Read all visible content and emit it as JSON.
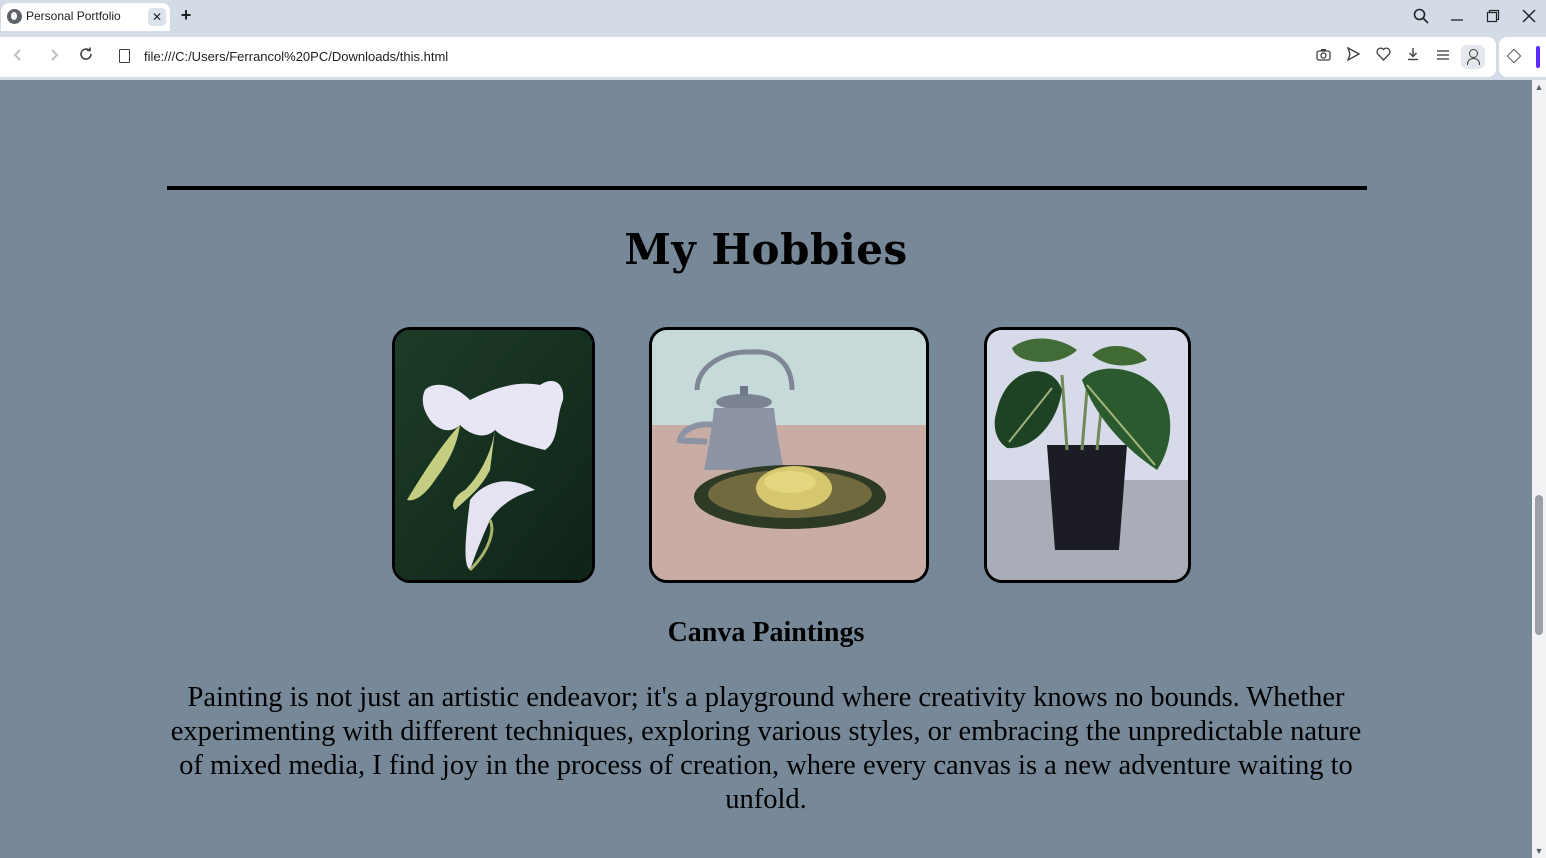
{
  "browser": {
    "tab_title": "Personal Portfolio",
    "tab_close": "✕",
    "new_tab": "+",
    "url": "file:///C:/Users/Ferrancol%20PC/Downloads/this.html",
    "icons": {
      "back": "back-arrow-icon",
      "forward": "forward-arrow-icon",
      "reload": "reload-icon",
      "file": "file-icon",
      "camera": "camera-icon",
      "send": "send-icon",
      "heart": "heart-icon",
      "download": "download-icon",
      "menu": "menu-icon",
      "profile": "profile-icon",
      "extensions": "cube-icon",
      "search": "search-icon",
      "minimize": "minimize-icon",
      "restore": "restore-icon",
      "close": "close-icon"
    }
  },
  "page": {
    "background": "#778899",
    "section_title": "My Hobbies",
    "gallery": [
      {
        "subject": "white calla lilies on dark green",
        "icon": "calla-lily-painting"
      },
      {
        "subject": "kettle with lemon on a tray",
        "icon": "kettle-lemon-painting"
      },
      {
        "subject": "potted plant in black pot",
        "icon": "potted-plant-painting"
      }
    ],
    "hobby_title": "Canva Paintings",
    "hobby_description": "Painting is not just an artistic endeavor; it's a playground where creativity knows no bounds. Whether experimenting with different techniques, exploring various styles, or embracing the unpredictable nature of mixed media, I find joy in the process of creation, where every canvas is a new adventure waiting to unfold."
  }
}
